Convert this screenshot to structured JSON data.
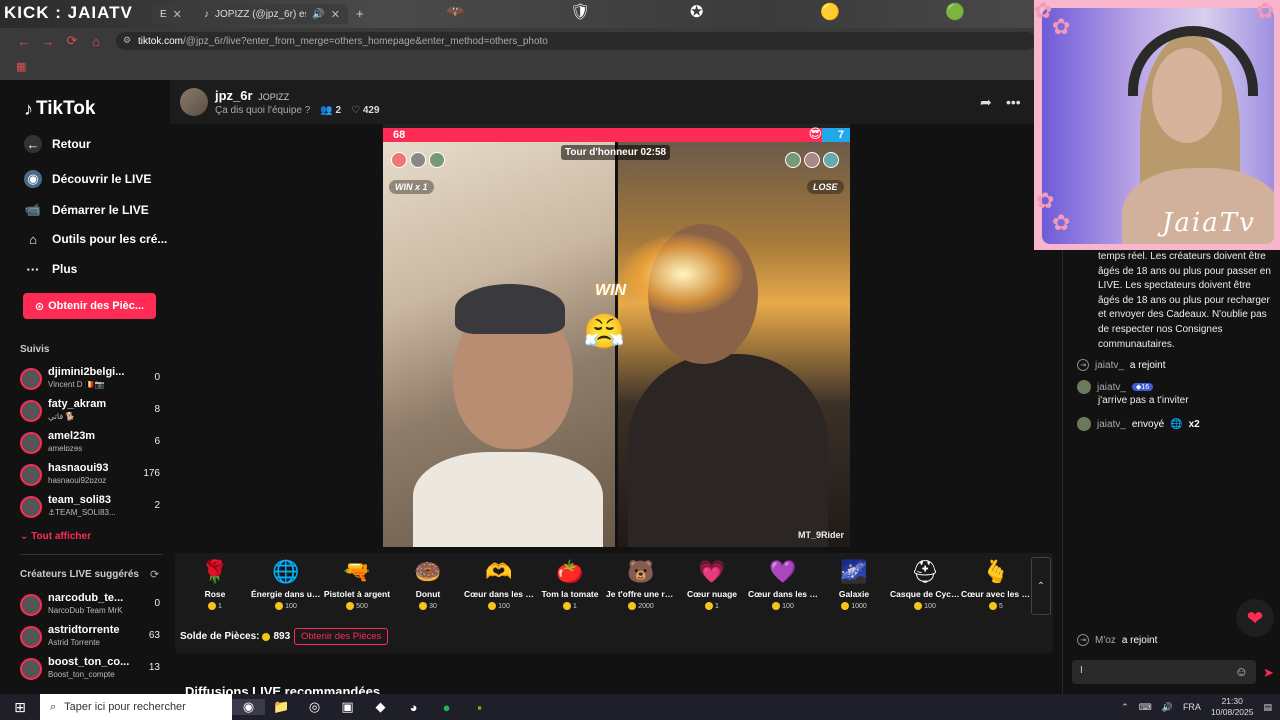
{
  "browser": {
    "overlay_title": "KICK : JAIATV",
    "tabs": [
      {
        "label": "E",
        "active": false
      },
      {
        "label": "JOPIZZ (@jpz_6r) est en LIV",
        "active": true
      }
    ],
    "url_site": "tiktok.com",
    "url_rest": "/@jpz_6r/live?enter_from_merge=others_homepage&enter_method=others_photo"
  },
  "sidebar": {
    "logo": "TikTok",
    "back": "Retour",
    "nav": [
      {
        "label": "Découvrir le LIVE",
        "icon": "live-avatar-icon"
      },
      {
        "label": "Démarrer le LIVE",
        "icon": "camera-icon"
      },
      {
        "label": "Outils pour les cré...",
        "icon": "home-icon"
      },
      {
        "label": "Plus",
        "icon": "more-dots-icon"
      }
    ],
    "coins_button": "Obtenir des Pièc...",
    "following_title": "Suivis",
    "following": [
      {
        "name": "djimini2belgi...",
        "sub": "Vincent D 🇧🇪📷",
        "count": "0"
      },
      {
        "name": "faty_akram",
        "sub": "فاتي 🐕",
        "count": "8"
      },
      {
        "name": "amel23m",
        "sub": "amelɒzɘs",
        "count": "6"
      },
      {
        "name": "hasnaoui93",
        "sub": "hasnaoui92ɒzoz",
        "count": "176"
      },
      {
        "name": "team_soli83",
        "sub": "⚓TEAM_SOLI83...",
        "count": "2"
      }
    ],
    "show_all": "Tout afficher",
    "suggested_title": "Créateurs LIVE suggérés",
    "suggested": [
      {
        "name": "narcodub_te...",
        "sub": "NarcoDub Team MrK",
        "count": "0"
      },
      {
        "name": "astridtorrente",
        "sub": "Astrid Torrente",
        "count": "63"
      },
      {
        "name": "boost_ton_co...",
        "sub": "Boost_ton_compte",
        "count": "13"
      }
    ]
  },
  "header": {
    "name": "jpz_6r",
    "handle": "JOPIZZ",
    "subtitle": "Ça dis quoi l'équipe ?",
    "viewers": "2",
    "likes": "429"
  },
  "battle": {
    "left_score": "68",
    "right_score": "7",
    "left_share": 0.94,
    "timer": "Tour d'honneur 02:58",
    "left_result": "WIN",
    "left_multiplier": "x 1",
    "right_result": "LOSE",
    "center_banner": "WIN",
    "watermark": "MT_9Rider"
  },
  "gifts": [
    {
      "name": "Rose",
      "price": "1",
      "icon": "🌹"
    },
    {
      "name": "Énergie dans un ...",
      "price": "100",
      "icon": "🌐"
    },
    {
      "name": "Pistolet à argent",
      "price": "500",
      "icon": "🔫"
    },
    {
      "name": "Donut",
      "price": "30",
      "icon": "🍩"
    },
    {
      "name": "Cœur dans les m...",
      "price": "100",
      "icon": "🫶"
    },
    {
      "name": "Tom la tomate",
      "price": "1",
      "icon": "🍅"
    },
    {
      "name": "Je t'offre une ros...",
      "price": "2000",
      "icon": "🐻"
    },
    {
      "name": "Cœur nuage",
      "price": "1",
      "icon": "💗"
    },
    {
      "name": "Cœur dans les m...",
      "price": "100",
      "icon": "💜"
    },
    {
      "name": "Galaxie",
      "price": "1000",
      "icon": "🌌"
    },
    {
      "name": "Casque de Cyclis...",
      "price": "100",
      "icon": "⛑"
    },
    {
      "name": "Cœur avec les do...",
      "price": "5",
      "icon": "🫰"
    }
  ],
  "balance_label": "Solde de Pièces:",
  "balance": "893",
  "get_coins": "Obtenir des Pièces",
  "recommended": "Diffusions LIVE recommandées",
  "chat": {
    "rules": "temps réel. Les créateurs doivent être âgés de 18 ans ou plus pour passer en LIVE. Les spectateurs doivent être âgés de 18 ans ou plus pour recharger et envoyer des Cadeaux. N'oublie pas de respecter nos Consignes communautaires.",
    "join1_user": "jaiatv_",
    "join1_text": "a rejoint",
    "msg_user": "jaiatv_",
    "msg_level": "16",
    "msg_text": "j'arrive pas a t'inviter",
    "gift_user": "jaiatv_",
    "gift_text": "envoyé",
    "gift_count": "x2",
    "join2_user": "M'oz",
    "join2_text": "a rejoint",
    "input_value": "I"
  },
  "webcam_label": "JaiaTv",
  "taskbar": {
    "search_placeholder": "Taper ici pour rechercher",
    "lang": "FRA",
    "time": "21:30",
    "date": "10/08/2025"
  }
}
